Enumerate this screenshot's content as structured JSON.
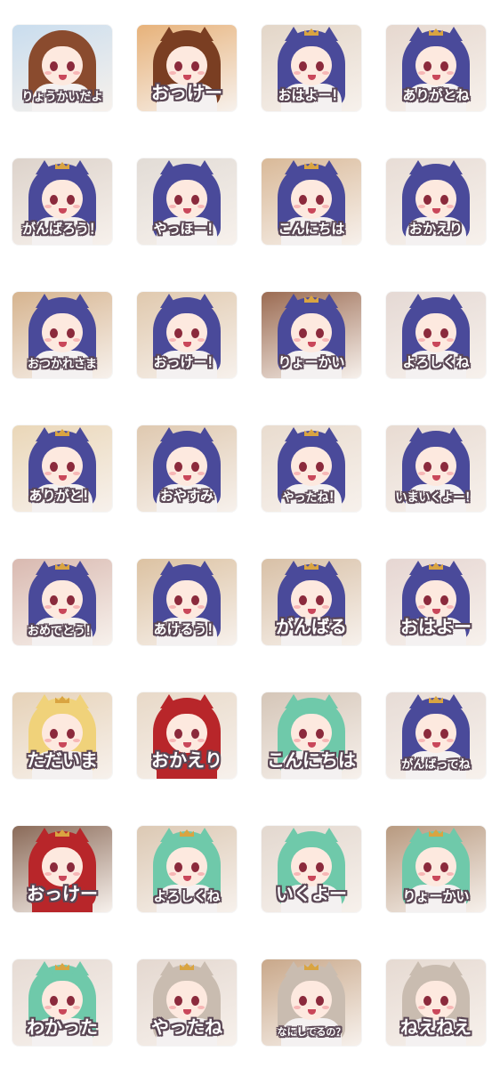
{
  "stickers": [
    {
      "label": "りょうかいだよ",
      "hair": "#8a4b2e",
      "body": "#f4f1f1",
      "bg": "#c9ddee",
      "ears": false,
      "crown": false,
      "size": "small"
    },
    {
      "label": "おっけー",
      "hair": "#7a3e22",
      "body": "#f4f1f1",
      "bg": "#e7b27a",
      "ears": true,
      "crown": false,
      "size": "large"
    },
    {
      "label": "おはよー！",
      "hair": "#4a4a9a",
      "body": "#f4f1f1",
      "bg": "#e3d6c8",
      "ears": true,
      "crown": true,
      "size": "medium"
    },
    {
      "label": "ありがとね",
      "hair": "#4a4a9a",
      "body": "#f4f1f1",
      "bg": "#e6d8cf",
      "ears": true,
      "crown": true,
      "size": "medium"
    },
    {
      "label": "がんばろう！",
      "hair": "#4a4a9a",
      "body": "#f4f1f1",
      "bg": "#ddd3cb",
      "ears": true,
      "crown": true,
      "size": "medium"
    },
    {
      "label": "やっほー！",
      "hair": "#4a4a9a",
      "body": "#f4f1f1",
      "bg": "#e2dcd6",
      "ears": true,
      "crown": false,
      "size": "medium"
    },
    {
      "label": "こんにちは",
      "hair": "#4a4a9a",
      "body": "#f4f1f1",
      "bg": "#d9b998",
      "ears": true,
      "crown": true,
      "size": "medium"
    },
    {
      "label": "おかえり",
      "hair": "#4a4a9a",
      "body": "#f4f1f1",
      "bg": "#e8ddd6",
      "ears": true,
      "crown": false,
      "size": "medium"
    },
    {
      "label": "おつかれさま",
      "hair": "#4a4a9a",
      "body": "#f4f1f1",
      "bg": "#d6b48f",
      "ears": true,
      "crown": false,
      "size": "small"
    },
    {
      "label": "おっけー！",
      "hair": "#4a4a9a",
      "body": "#f4f1f1",
      "bg": "#e0c9ae",
      "ears": true,
      "crown": false,
      "size": "medium"
    },
    {
      "label": "りょーかい",
      "hair": "#4a4a9a",
      "body": "#f4f1f1",
      "bg": "#9b6b52",
      "ears": true,
      "crown": true,
      "size": "medium"
    },
    {
      "label": "よろしくね",
      "hair": "#4a4a9a",
      "body": "#f4f1f1",
      "bg": "#e5d9d4",
      "ears": true,
      "crown": false,
      "size": "medium"
    },
    {
      "label": "ありがと！",
      "hair": "#4a4a9a",
      "body": "#f4f1f1",
      "bg": "#ead7b8",
      "ears": true,
      "crown": true,
      "size": "medium"
    },
    {
      "label": "おやすみ",
      "hair": "#4a4a9a",
      "body": "#f4f1f1",
      "bg": "#dfc9b0",
      "ears": true,
      "crown": false,
      "size": "medium"
    },
    {
      "label": "やったね！",
      "hair": "#4a4a9a",
      "body": "#f4f1f1",
      "bg": "#e9dccf",
      "ears": true,
      "crown": true,
      "size": "small"
    },
    {
      "label": "いまいくよー！",
      "hair": "#4a4a9a",
      "body": "#f4f1f1",
      "bg": "#e8dbd2",
      "ears": true,
      "crown": false,
      "size": "small"
    },
    {
      "label": "おめでとう！",
      "hair": "#4a4a9a",
      "body": "#f4f1f1",
      "bg": "#d9b9b0",
      "ears": true,
      "crown": true,
      "size": "small"
    },
    {
      "label": "あけるう！",
      "hair": "#4a4a9a",
      "body": "#f4f1f1",
      "bg": "#dcc2a2",
      "ears": true,
      "crown": false,
      "size": "medium"
    },
    {
      "label": "がんばる",
      "hair": "#4a4a9a",
      "body": "#f4f1f1",
      "bg": "#d8c0a6",
      "ears": true,
      "crown": true,
      "size": "large"
    },
    {
      "label": "おはよー",
      "hair": "#4a4a9a",
      "body": "#f4f1f1",
      "bg": "#e6d6d2",
      "ears": true,
      "crown": true,
      "size": "large"
    },
    {
      "label": "ただいま",
      "hair": "#f0d27a",
      "body": "#f4f1f1",
      "bg": "#e6d2b8",
      "ears": true,
      "crown": true,
      "size": "large"
    },
    {
      "label": "おかえり",
      "hair": "#b8262a",
      "body": "#b8262a",
      "bg": "#e8d9c8",
      "ears": true,
      "crown": false,
      "size": "large"
    },
    {
      "label": "こんにちは",
      "hair": "#6fc9aa",
      "body": "#f4f1f1",
      "bg": "#d5c6b8",
      "ears": true,
      "crown": false,
      "size": "large"
    },
    {
      "label": "がんばってね",
      "hair": "#4a4a9a",
      "body": "#f4f1f1",
      "bg": "#e7dcd6",
      "ears": true,
      "crown": true,
      "size": "small"
    },
    {
      "label": "おっけー",
      "hair": "#b8262a",
      "body": "#b8262a",
      "bg": "#8a6a58",
      "ears": true,
      "crown": true,
      "size": "large"
    },
    {
      "label": "よろしくね",
      "hair": "#6fc9aa",
      "body": "#f4f1f1",
      "bg": "#dcc9b4",
      "ears": true,
      "crown": true,
      "size": "medium"
    },
    {
      "label": "いくよー",
      "hair": "#6fc9aa",
      "body": "#f4f1f1",
      "bg": "#e3d8cf",
      "ears": true,
      "crown": false,
      "size": "large"
    },
    {
      "label": "りょーかい",
      "hair": "#6fc9aa",
      "body": "#f4f1f1",
      "bg": "#b89a80",
      "ears": true,
      "crown": true,
      "size": "medium"
    },
    {
      "label": "わかった",
      "hair": "#6fc9aa",
      "body": "#f4f1f1",
      "bg": "#e6dbd4",
      "ears": true,
      "crown": true,
      "size": "large"
    },
    {
      "label": "やったね",
      "hair": "#c9bcb0",
      "body": "#f4f1f1",
      "bg": "#e4d8d0",
      "ears": true,
      "crown": true,
      "size": "large"
    },
    {
      "label": "なにしてるの？",
      "hair": "#c9bcb0",
      "body": "#f4f1f1",
      "bg": "#c9a88a",
      "ears": true,
      "crown": true,
      "size": "xsmall"
    },
    {
      "label": "ねえねえ",
      "hair": "#c9bcb0",
      "body": "#f4f1f1",
      "bg": "#e6dad2",
      "ears": true,
      "crown": false,
      "size": "large"
    }
  ]
}
